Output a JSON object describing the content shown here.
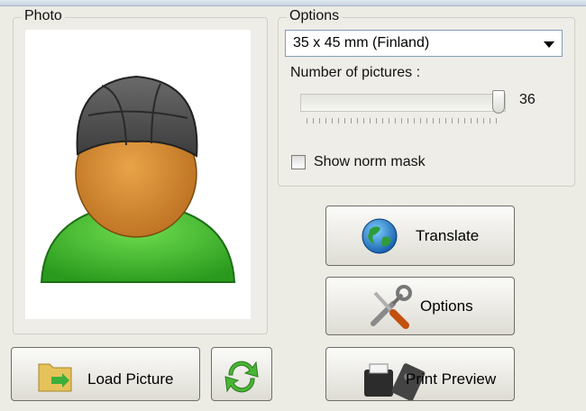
{
  "photo_group": {
    "title": "Photo"
  },
  "options_group": {
    "title": "Options",
    "format_select": {
      "value": "35 x 45 mm (Finland)"
    },
    "pictures_label": "Number of pictures :",
    "pictures_slider": {
      "value": 36,
      "display": "36"
    },
    "norm_mask": {
      "label": "Show norm mask",
      "checked": false
    }
  },
  "buttons": {
    "translate": "Translate",
    "options": "Options",
    "load_picture": "Load Picture",
    "print_preview": "Print Preview"
  },
  "icons": {
    "avatar": "user-silhouette-icon",
    "translate": "globe-icon",
    "options": "tools-icon",
    "load": "folder-icon",
    "refresh": "refresh-arrows-icon",
    "print": "printer-icon"
  }
}
